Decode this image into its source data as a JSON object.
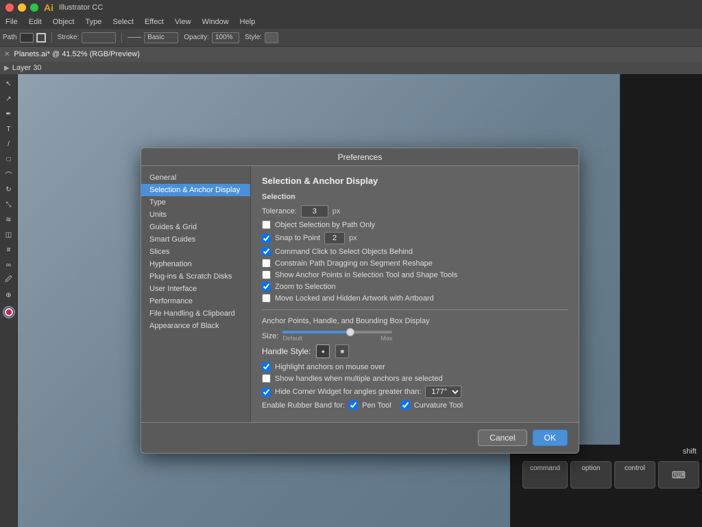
{
  "app": {
    "name": "Illustrator CC",
    "menuItems": [
      "File",
      "Edit",
      "Object",
      "Type",
      "Select",
      "Effect",
      "View",
      "Window",
      "Help"
    ]
  },
  "titleBar": {
    "trafficLights": [
      "red",
      "yellow",
      "green"
    ]
  },
  "tabBar": {
    "activeTab": "Planets.ai* @ 41.52% (RGB/Preview)"
  },
  "layerBar": {
    "layer": "Layer 30"
  },
  "toolbar": {
    "path_label": "Path",
    "stroke_label": "Stroke:",
    "style_label": "Basic",
    "opacity_label": "Opacity:",
    "opacity_value": "100%",
    "style2_label": "Style:"
  },
  "dialog": {
    "title": "Preferences",
    "sidebar": {
      "items": [
        {
          "id": "general",
          "label": "General"
        },
        {
          "id": "selection-anchor",
          "label": "Selection & Anchor Display",
          "active": true
        },
        {
          "id": "type",
          "label": "Type"
        },
        {
          "id": "units",
          "label": "Units"
        },
        {
          "id": "guides-grid",
          "label": "Guides & Grid"
        },
        {
          "id": "smart-guides",
          "label": "Smart Guides"
        },
        {
          "id": "slices",
          "label": "Slices"
        },
        {
          "id": "hyphenation",
          "label": "Hyphenation"
        },
        {
          "id": "plug-ins",
          "label": "Plug-ins & Scratch Disks"
        },
        {
          "id": "user-interface",
          "label": "User Interface"
        },
        {
          "id": "performance",
          "label": "Performance"
        },
        {
          "id": "file-handling",
          "label": "File Handling & Clipboard"
        },
        {
          "id": "appearance",
          "label": "Appearance of Black"
        }
      ]
    },
    "content": {
      "sectionTitle": "Selection & Anchor Display",
      "selectionTitle": "Selection",
      "toleranceLabel": "Tolerance:",
      "toleranceValue": "3",
      "toleranceUnit": "px",
      "checkboxes": [
        {
          "id": "obj-selection",
          "label": "Object Selection by Path Only",
          "checked": false
        },
        {
          "id": "snap-to-point",
          "label": "Snap to Point",
          "checked": true,
          "hasInput": true,
          "inputValue": "2",
          "inputUnit": "px"
        },
        {
          "id": "cmd-click",
          "label": "Command Click to Select Objects Behind",
          "checked": true
        },
        {
          "id": "constrain-path",
          "label": "Constrain Path Dragging on Segment Reshape",
          "checked": false
        },
        {
          "id": "show-anchor",
          "label": "Show Anchor Points in Selection Tool and Shape Tools",
          "checked": false
        },
        {
          "id": "zoom-selection",
          "label": "Zoom to Selection",
          "checked": true
        },
        {
          "id": "move-locked",
          "label": "Move Locked and Hidden Artwork with Artboard",
          "checked": false
        }
      ],
      "anchorSectionTitle": "Anchor Points, Handle, and Bounding Box Display",
      "sizeLabel": "Size:",
      "sliderMin": "Default",
      "sliderMax": "Max",
      "handleStyleLabel": "Handle Style:",
      "anchorCheckboxes": [
        {
          "id": "highlight-anchors",
          "label": "Highlight anchors on mouse over",
          "checked": true
        },
        {
          "id": "show-handles",
          "label": "Show handles when multiple anchors are selected",
          "checked": false
        },
        {
          "id": "hide-corner",
          "label": "Hide Corner Widget for angles greater than:",
          "checked": true,
          "hasSelect": true,
          "selectValue": "177°"
        }
      ],
      "rubberBandLabel": "Enable Rubber Band for:",
      "rubberBandCheckboxes": [
        {
          "id": "pen-tool",
          "label": "Pen Tool",
          "checked": true
        },
        {
          "id": "curvature-tool",
          "label": "Curvature Tool",
          "checked": true
        }
      ],
      "cancelLabel": "Cancel",
      "okLabel": "OK"
    }
  },
  "keyboard": {
    "shiftLabel": "shift",
    "keys": [
      "command",
      "option",
      "control"
    ],
    "keyboardIcon": "⌨"
  }
}
